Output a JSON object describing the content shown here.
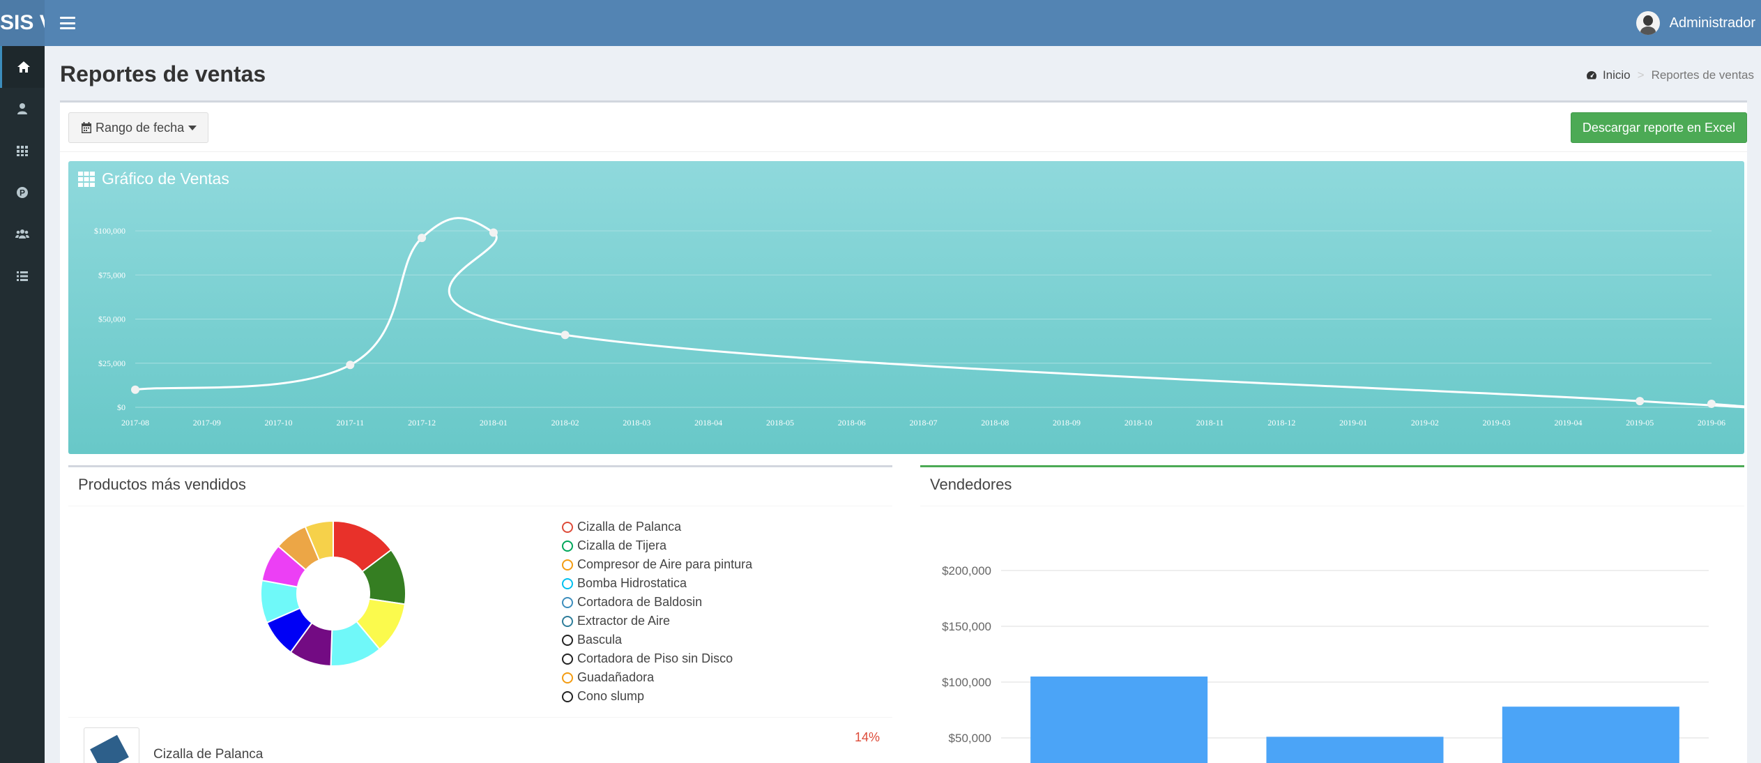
{
  "header": {
    "logo": "SIS V",
    "user_name": "Administrador"
  },
  "sidebar": {
    "items": [
      {
        "name": "home-icon",
        "active": true
      },
      {
        "name": "user-icon",
        "active": false
      },
      {
        "name": "grid-icon",
        "active": false
      },
      {
        "name": "p-icon",
        "active": false
      },
      {
        "name": "users-icon",
        "active": false
      },
      {
        "name": "list-icon",
        "active": false
      }
    ]
  },
  "page": {
    "title": "Reportes de ventas",
    "breadcrumb": {
      "home": "Inicio",
      "current": "Reportes de ventas"
    }
  },
  "toolbar": {
    "date_range_label": "Rango de fecha",
    "excel_label": "Descargar reporte en Excel"
  },
  "sales_chart": {
    "title": "Gráfico de Ventas"
  },
  "top_products": {
    "title": "Productos más vendidos",
    "first_item": {
      "name": "Cizalla de Palanca",
      "percent": "14%"
    }
  },
  "sellers": {
    "title": "Vendedores"
  },
  "chart_data": [
    {
      "type": "line",
      "title": "Gráfico de Ventas",
      "x": [
        "2017-08",
        "2017-09",
        "2017-10",
        "2017-11",
        "2017-12",
        "2018-01",
        "2018-02",
        "2018-03",
        "2018-04",
        "2018-05",
        "2018-06",
        "2018-07",
        "2018-08",
        "2018-09",
        "2018-10",
        "2018-11",
        "2018-12",
        "2019-01",
        "2019-02",
        "2019-03",
        "2019-04",
        "2019-05",
        "2019-06"
      ],
      "points": [
        {
          "x": "2017-08",
          "y": 10000
        },
        {
          "x": "2017-11",
          "y": 24000
        },
        {
          "x": "2017-12",
          "y": 96000
        },
        {
          "x": "2018-01",
          "y": 99000
        },
        {
          "x": "2018-02",
          "y": 41000
        },
        {
          "x": "2019-05",
          "y": 3500
        },
        {
          "x": "2019-06",
          "y": 2000
        }
      ],
      "yticks": [
        "$0",
        "$25,000",
        "$50,000",
        "$75,000",
        "$100,000"
      ],
      "ylim": [
        0,
        100000
      ],
      "grid": true,
      "colors": {
        "line": "#ffffff",
        "grid": "#a8e0e2",
        "text": "#ffffff"
      }
    },
    {
      "type": "pie",
      "title": "Productos más vendidos",
      "labels": [
        "Cizalla de Palanca",
        "Cizalla de Tijera",
        "Compresor de Aire para pintura",
        "Bomba Hidrostatica",
        "Cortadora de Baldosin",
        "Extractor de Aire",
        "Bascula",
        "Cortadora de Piso sin Disco",
        "Guadañadora",
        "Cono slump"
      ],
      "values": [
        14,
        12,
        11,
        11,
        9,
        8,
        9,
        8,
        7,
        6
      ],
      "colors": [
        "#e8312a",
        "#357e22",
        "#fbfa4d",
        "#70f8f9",
        "#730b83",
        "#0000f5",
        "#6ff9f9",
        "#ec3ff5",
        "#eca646",
        "#f6d14a"
      ],
      "legend_colors": [
        "#dd4b39",
        "#00a65a",
        "#f39c12",
        "#00c0ef",
        "#3c8dbc",
        "#2e7d9a",
        "#222222",
        "#222222",
        "#f39c12",
        "#222222"
      ],
      "donut": true
    },
    {
      "type": "bar",
      "title": "Vendedores",
      "categories": [
        "",
        "",
        ""
      ],
      "values": [
        105000,
        51000,
        78000
      ],
      "yticks": [
        "$50,000",
        "$100,000",
        "$150,000",
        "$200,000"
      ],
      "ylim": [
        0,
        200000
      ],
      "grid": true,
      "colors": {
        "bar": "#4ba4f7",
        "grid": "#dddddd",
        "text": "#666666"
      }
    }
  ]
}
